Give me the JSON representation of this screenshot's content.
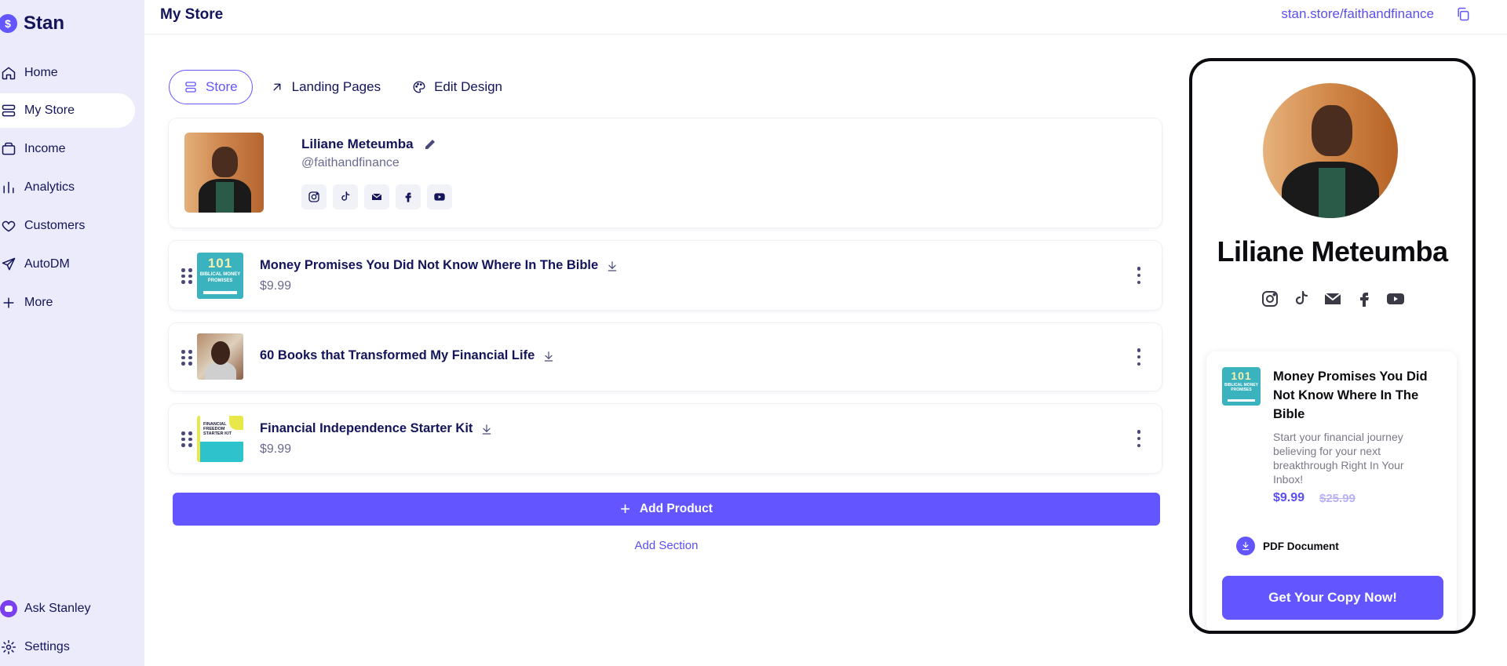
{
  "brand": {
    "name": "Stan",
    "badge": "$"
  },
  "sidebar": {
    "items": [
      {
        "label": "Home",
        "icon": "home-icon"
      },
      {
        "label": "My Store",
        "icon": "store-icon",
        "active": true
      },
      {
        "label": "Income",
        "icon": "wallet-icon"
      },
      {
        "label": "Analytics",
        "icon": "bar-chart-icon"
      },
      {
        "label": "Customers",
        "icon": "heart-icon"
      },
      {
        "label": "AutoDM",
        "icon": "send-icon"
      },
      {
        "label": "More",
        "icon": "plus-icon"
      }
    ],
    "bottom": [
      {
        "label": "Ask Stanley",
        "icon": "stanley-icon"
      },
      {
        "label": "Settings",
        "icon": "gear-icon"
      }
    ]
  },
  "header": {
    "title": "My Store",
    "store_url": "stan.store/faithandfinance"
  },
  "tabs": [
    {
      "label": "Store",
      "icon": "stack-icon",
      "active": true
    },
    {
      "label": "Landing Pages",
      "icon": "arrow-up-right-icon"
    },
    {
      "label": "Edit Design",
      "icon": "palette-icon"
    }
  ],
  "profile": {
    "name": "Liliane Meteumba",
    "handle": "@faithandfinance",
    "socials": [
      "instagram-icon",
      "tiktok-icon",
      "mail-icon",
      "facebook-icon",
      "youtube-icon"
    ]
  },
  "products": [
    {
      "title": "Money Promises You Did Not Know Where In The Bible",
      "price": "$9.99",
      "thumb_big": "101",
      "thumb_small": "BIBLICAL MONEY PROMISES"
    },
    {
      "title": "60 Books that Transformed My Financial Life",
      "price": ""
    },
    {
      "title": "Financial Independence Starter Kit",
      "price": "$9.99",
      "thumb_text": "FINANCIAL FREEDOM STARTER KIT"
    }
  ],
  "actions": {
    "add_product": "Add Product",
    "add_section": "Add Section"
  },
  "preview": {
    "name": "Liliane Meteumba",
    "product": {
      "title": "Money Promises You Did Not Know Where In The Bible",
      "description": "Start your financial journey believing for your next breakthrough Right In Your Inbox!",
      "price": "$9.99",
      "old_price": "$25.99",
      "thumb_big": "101",
      "thumb_small": "BIBLICAL MONEY PROMISES",
      "type_label": "PDF Document",
      "cta": "Get Your Copy Now!"
    }
  },
  "colors": {
    "accent": "#6355ff",
    "sidebar_bg": "#ebebfb",
    "text": "#14145a"
  }
}
